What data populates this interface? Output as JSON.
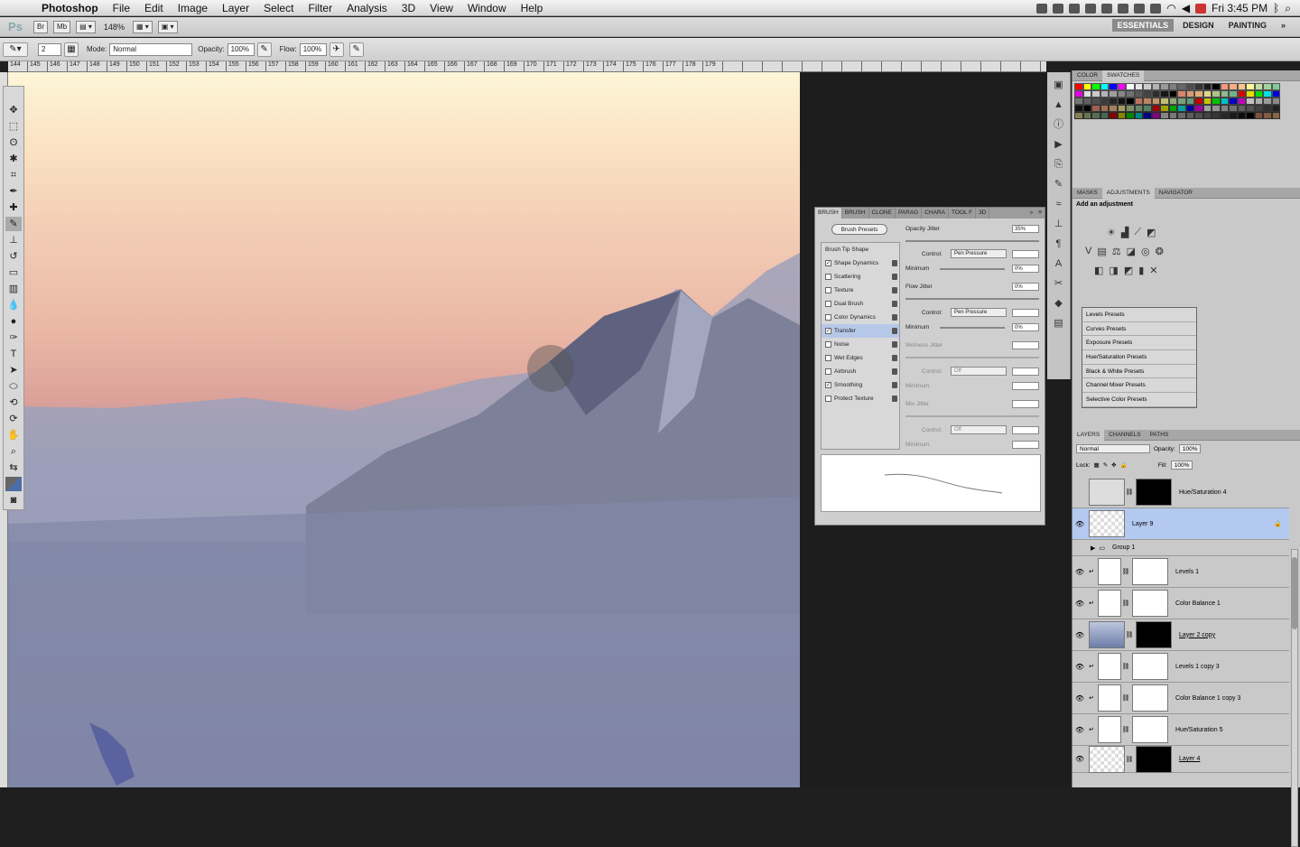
{
  "menubar": {
    "app": "Photoshop",
    "items": [
      "File",
      "Edit",
      "Image",
      "Layer",
      "Select",
      "Filter",
      "Analysis",
      "3D",
      "View",
      "Window",
      "Help"
    ],
    "clock": "Fri 3:45 PM"
  },
  "appbar": {
    "logo": "Ps",
    "br": "Br",
    "mb": "Mb",
    "zoom": "148%",
    "workspaces": [
      "ESSENTIALS",
      "DESIGN",
      "PAINTING"
    ]
  },
  "options": {
    "brush_size": "2",
    "mode_label": "Mode:",
    "mode_value": "Normal",
    "opacity_label": "Opacity:",
    "opacity_value": "100%",
    "flow_label": "Flow:",
    "flow_value": "100%"
  },
  "ruler_numbers": [
    "144",
    "145",
    "146",
    "147",
    "148",
    "149",
    "150",
    "151",
    "152",
    "153",
    "154",
    "155",
    "156",
    "157",
    "158",
    "159",
    "160",
    "161",
    "162",
    "163",
    "164",
    "165",
    "166",
    "167",
    "168",
    "169",
    "170",
    "171",
    "172",
    "173",
    "174",
    "175",
    "176",
    "177",
    "178",
    "179"
  ],
  "brush_panel": {
    "tabs": [
      "BRUSH",
      "BRUSH",
      "CLONE",
      "PARAG",
      "CHARA",
      "TOOL F",
      "3D"
    ],
    "presets_button": "Brush Presets",
    "tip_shape": "Brush Tip Shape",
    "options": [
      {
        "label": "Shape Dynamics",
        "checked": "✓"
      },
      {
        "label": "Scattering",
        "checked": ""
      },
      {
        "label": "Texture",
        "checked": ""
      },
      {
        "label": "Dual Brush",
        "checked": ""
      },
      {
        "label": "Color Dynamics",
        "checked": ""
      },
      {
        "label": "Transfer",
        "checked": "✓"
      },
      {
        "label": "Noise",
        "checked": ""
      },
      {
        "label": "Wet Edges",
        "checked": ""
      },
      {
        "label": "Airbrush",
        "checked": ""
      },
      {
        "label": "Smoothing",
        "checked": "✓"
      },
      {
        "label": "Protect Texture",
        "checked": ""
      }
    ],
    "opacity_jitter_label": "Opacity Jitter",
    "opacity_jitter_value": "35%",
    "control_label": "Control:",
    "control_value": "Pen Pressure",
    "minimum_label": "Minimum",
    "minimum_value": "0%",
    "flow_jitter_label": "Flow Jitter",
    "flow_jitter_value": "0%",
    "control2_value": "Pen Pressure",
    "minimum2_value": "0%",
    "wetness_label": "Wetness Jitter",
    "control3_value": "Off",
    "mix_label": "Mix Jitter",
    "control4_value": "Off"
  },
  "swatches_panel": {
    "tabs": [
      "COLOR",
      "SWATCHES"
    ]
  },
  "adjustments_panel": {
    "tabs": [
      "MASKS",
      "ADJUSTMENTS",
      "NAVIGATOR"
    ],
    "heading": "Add an adjustment",
    "presets": [
      "Levels Presets",
      "Curves Presets",
      "Exposure Presets",
      "Hue/Saturation Presets",
      "Black & White Presets",
      "Channel Mixer Presets",
      "Selective Color Presets"
    ]
  },
  "layers_panel": {
    "tabs": [
      "LAYERS",
      "CHANNELS",
      "PATHS"
    ],
    "blend_mode": "Normal",
    "opacity_label": "Opacity:",
    "opacity_value": "100%",
    "lock_label": "Lock:",
    "fill_label": "Fill:",
    "fill_value": "100%",
    "layers": [
      {
        "name": "Hue/Saturation 4"
      },
      {
        "name": "Layer 9"
      },
      {
        "name": "Group 1"
      },
      {
        "name": "Levels 1"
      },
      {
        "name": "Color Balance 1"
      },
      {
        "name": "Layer 2 copy"
      },
      {
        "name": "Levels 1 copy 3"
      },
      {
        "name": "Color Balance 1 copy 3"
      },
      {
        "name": "Hue/Saturation 5"
      },
      {
        "name": "Layer 4"
      }
    ]
  }
}
